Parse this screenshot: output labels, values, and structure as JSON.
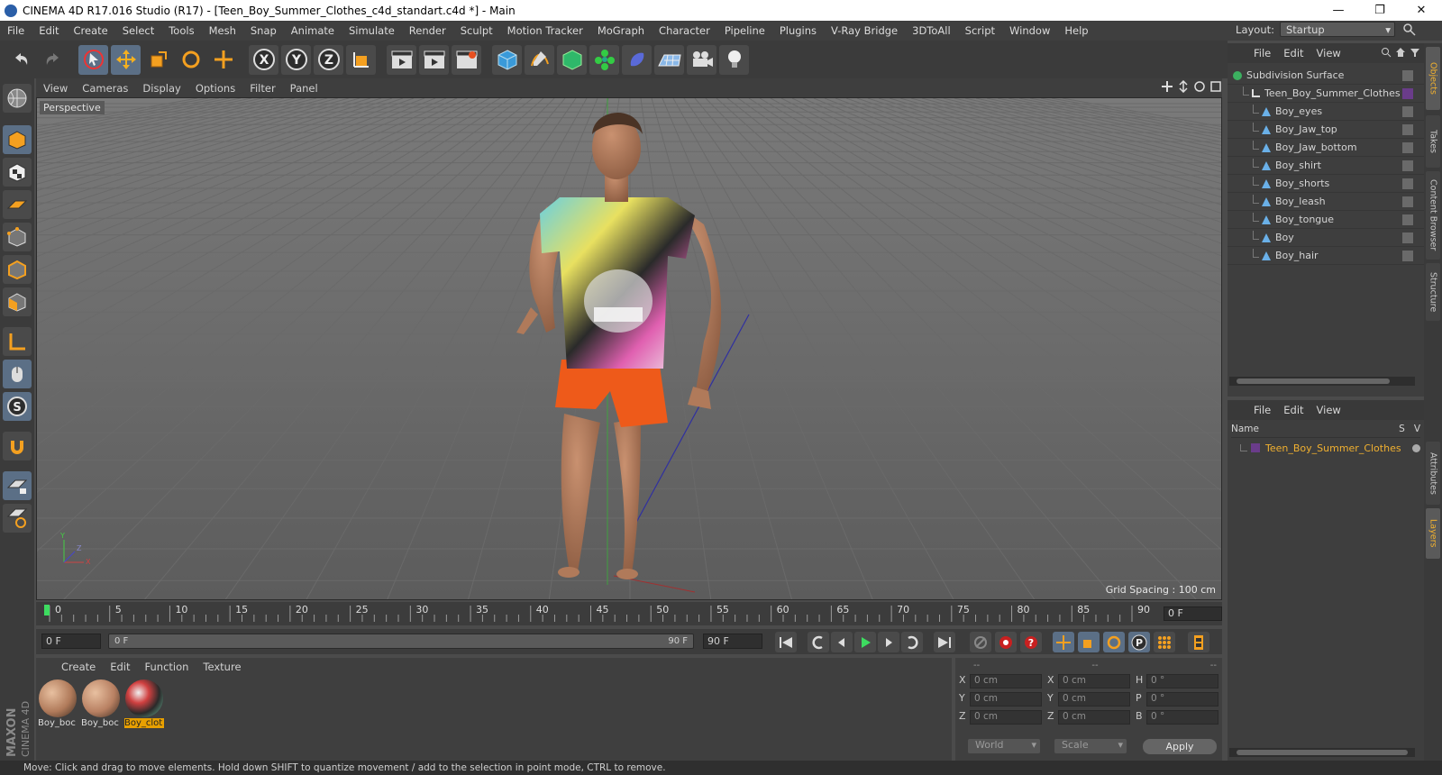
{
  "window": {
    "title": "CINEMA 4D R17.016 Studio (R17) - [Teen_Boy_Summer_Clothes_c4d_standart.c4d *] - Main",
    "minimize": "—",
    "maximize": "❐",
    "close": "✕"
  },
  "menu": [
    "File",
    "Edit",
    "Create",
    "Select",
    "Tools",
    "Mesh",
    "Snap",
    "Animate",
    "Simulate",
    "Render",
    "Sculpt",
    "Motion Tracker",
    "MoGraph",
    "Character",
    "Pipeline",
    "Plugins",
    "V-Ray Bridge",
    "3DToAll",
    "Script",
    "Window",
    "Help"
  ],
  "layout": {
    "label": "Layout:",
    "value": "Startup"
  },
  "viewport": {
    "menu": [
      "View",
      "Cameras",
      "Display",
      "Options",
      "Filter",
      "Panel"
    ],
    "label": "Perspective",
    "grid_spacing": "Grid Spacing : 100 cm"
  },
  "timeline": {
    "ticks": [
      "0",
      "5",
      "10",
      "15",
      "20",
      "25",
      "30",
      "35",
      "40",
      "45",
      "50",
      "55",
      "60",
      "65",
      "70",
      "75",
      "80",
      "85",
      "90"
    ],
    "current_frame": "0 F"
  },
  "transport": {
    "start_field": "0 F",
    "slider_start": "0 F",
    "slider_end": "90 F",
    "end_field": "90 F"
  },
  "materials": {
    "menu": [
      "Create",
      "Edit",
      "Function",
      "Texture"
    ],
    "items": [
      {
        "label": "Boy_boc",
        "color": "#b07a5a"
      },
      {
        "label": "Boy_boc",
        "color": "#b88062"
      },
      {
        "label": "Boy_clot",
        "color": "#8a8a8a"
      }
    ]
  },
  "coords": {
    "header": [
      "--",
      "--",
      "--"
    ],
    "rows": [
      {
        "a": "X",
        "av": "0 cm",
        "b": "X",
        "bv": "0 cm",
        "c": "H",
        "cv": "0 °"
      },
      {
        "a": "Y",
        "av": "0 cm",
        "b": "Y",
        "bv": "0 cm",
        "c": "P",
        "cv": "0 °"
      },
      {
        "a": "Z",
        "av": "0 cm",
        "b": "Z",
        "bv": "0 cm",
        "c": "B",
        "cv": "0 °"
      }
    ],
    "mode1": "World",
    "mode2": "Scale",
    "apply": "Apply"
  },
  "objects": {
    "menu": [
      "File",
      "Edit",
      "View"
    ],
    "items": [
      {
        "name": "Subdivision Surface",
        "depth": 0,
        "kind": "subd"
      },
      {
        "name": "Teen_Boy_Summer_Clothes",
        "depth": 1,
        "kind": "null"
      },
      {
        "name": "Boy_eyes",
        "depth": 2,
        "kind": "poly"
      },
      {
        "name": "Boy_Jaw_top",
        "depth": 2,
        "kind": "poly"
      },
      {
        "name": "Boy_Jaw_bottom",
        "depth": 2,
        "kind": "poly"
      },
      {
        "name": "Boy_shirt",
        "depth": 2,
        "kind": "poly"
      },
      {
        "name": "Boy_shorts",
        "depth": 2,
        "kind": "poly"
      },
      {
        "name": "Boy_leash",
        "depth": 2,
        "kind": "poly"
      },
      {
        "name": "Boy_tongue",
        "depth": 2,
        "kind": "poly"
      },
      {
        "name": "Boy",
        "depth": 2,
        "kind": "poly"
      },
      {
        "name": "Boy_hair",
        "depth": 2,
        "kind": "poly"
      }
    ]
  },
  "layers": {
    "menu": [
      "File",
      "Edit",
      "View"
    ],
    "col_name": "Name",
    "col_s": "S",
    "col_v": "V",
    "item": "Teen_Boy_Summer_Clothes"
  },
  "side_tabs": [
    "Objects",
    "Takes",
    "Content Browser",
    "Structure",
    "Attributes",
    "Layers"
  ],
  "logo": {
    "maxon": "MAXON",
    "cinema": "CINEMA 4D"
  },
  "status": "Move: Click and drag to move elements. Hold down SHIFT to quantize movement / add to the selection in point mode, CTRL to remove.",
  "colors": {
    "accent": "#e8a000",
    "panel": "#3e3e3e",
    "viewport": "#636363",
    "highlight": "#5b6f86"
  }
}
